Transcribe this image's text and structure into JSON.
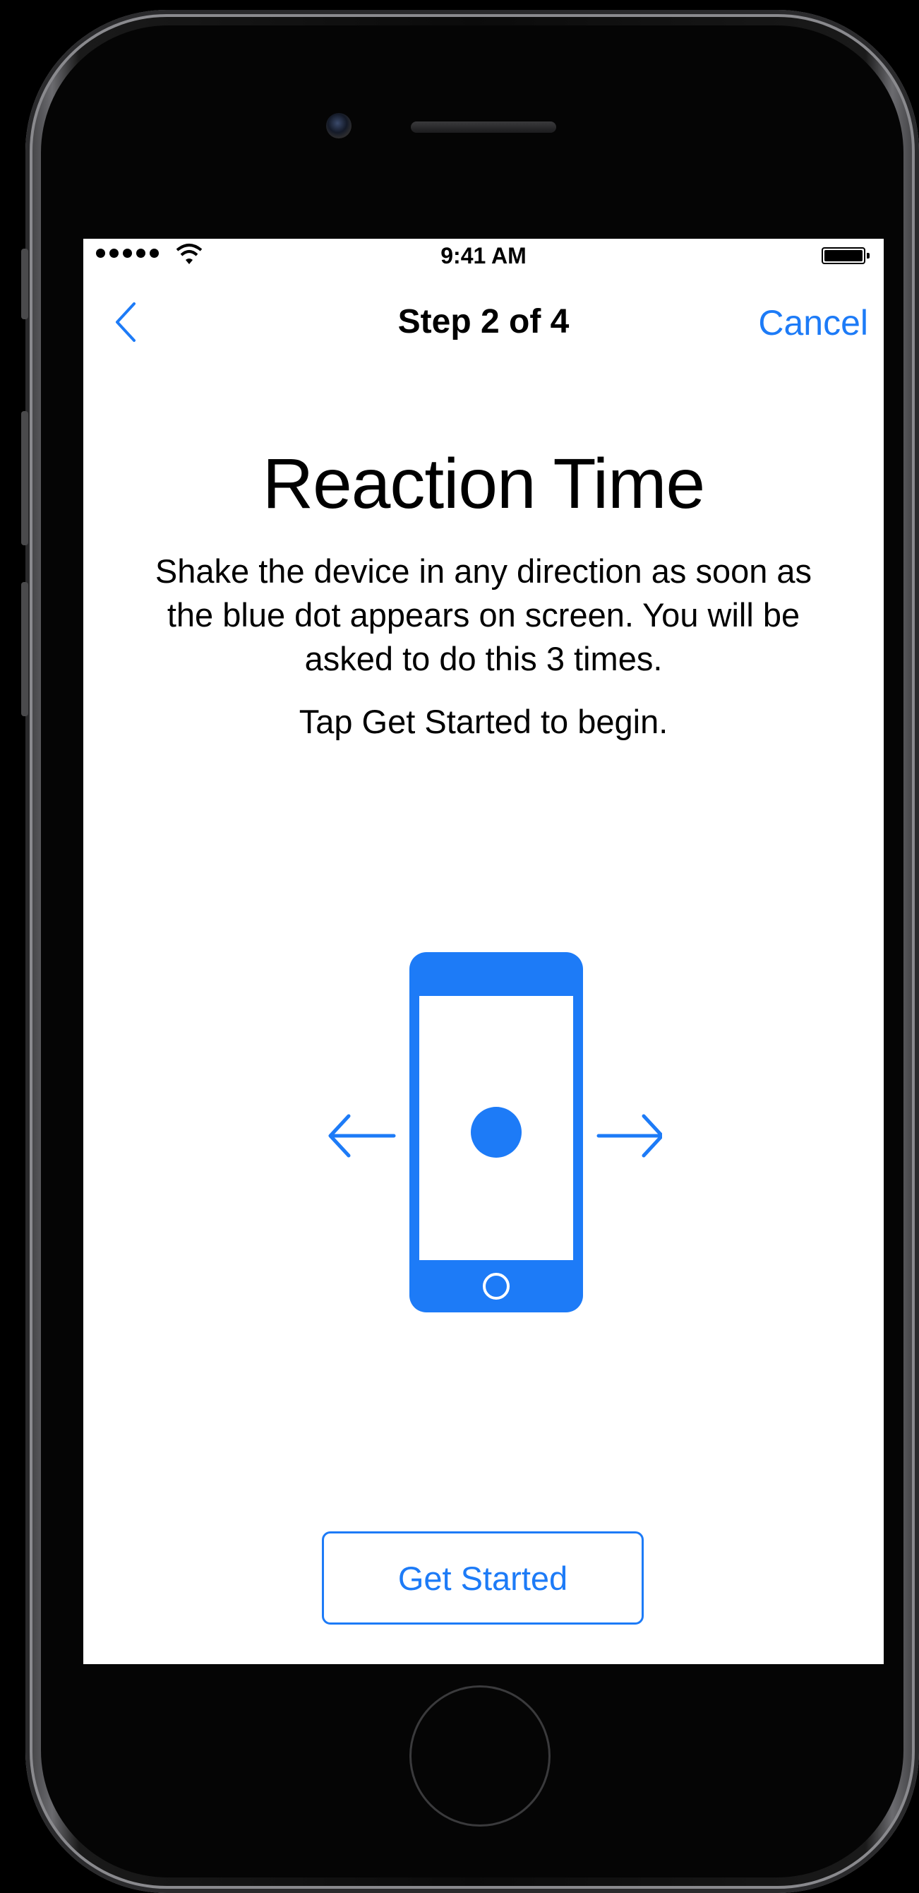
{
  "status_bar": {
    "time": "9:41 AM",
    "signal_icon": "cellular-signal-dots",
    "wifi_icon": "wifi-icon",
    "battery_icon": "battery-full-icon",
    "battery_level": 1.0
  },
  "nav": {
    "back_icon": "chevron-left-icon",
    "title": "Step 2 of 4",
    "cancel_label": "Cancel"
  },
  "content": {
    "heading": "Reaction Time",
    "instructions": "Shake the device in any direction as soon as the blue dot appears on screen. You will be asked to do this 3 times.",
    "prompt": "Tap Get Started to begin.",
    "illustration_icons": [
      "arrow-left-icon",
      "phone-icon",
      "blue-dot",
      "arrow-right-icon"
    ]
  },
  "actions": {
    "get_started_label": "Get Started"
  },
  "colors": {
    "accent": "#1d7bf7",
    "background": "#ffffff",
    "text": "#000000",
    "device_frame": "#000000"
  }
}
